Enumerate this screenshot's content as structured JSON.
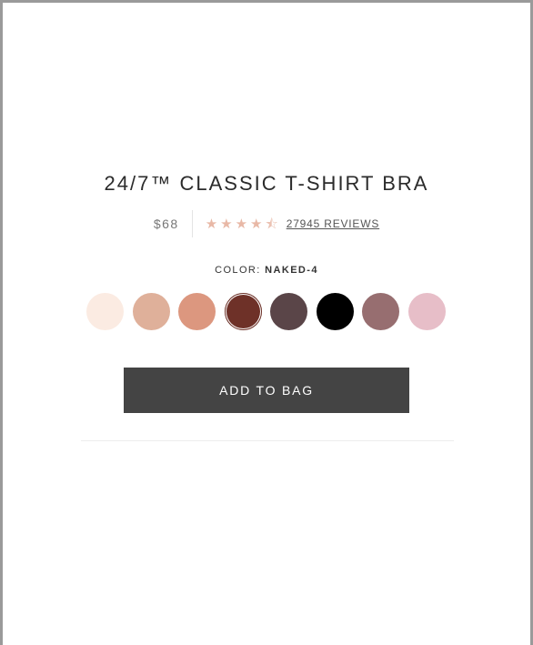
{
  "product": {
    "title": "24/7™ CLASSIC T-SHIRT BRA",
    "price": "$68",
    "rating": 4.5,
    "rating_max": 5,
    "reviews_label": "27945 REVIEWS"
  },
  "color": {
    "label": "COLOR:",
    "selected_name": "NAKED-4",
    "swatches": [
      {
        "hex": "#fbebe2"
      },
      {
        "hex": "#dfb09a"
      },
      {
        "hex": "#dc977f"
      },
      {
        "hex": "#6e3128"
      },
      {
        "hex": "#5a4548"
      },
      {
        "hex": "#000000"
      },
      {
        "hex": "#976e70"
      },
      {
        "hex": "#e7bec8"
      }
    ],
    "selected_index": 3
  },
  "actions": {
    "add_to_bag_label": "ADD TO BAG"
  },
  "colors": {
    "button_bg": "#444444",
    "star": "#e8b8a6",
    "frame_border": "#9a9a9a"
  }
}
